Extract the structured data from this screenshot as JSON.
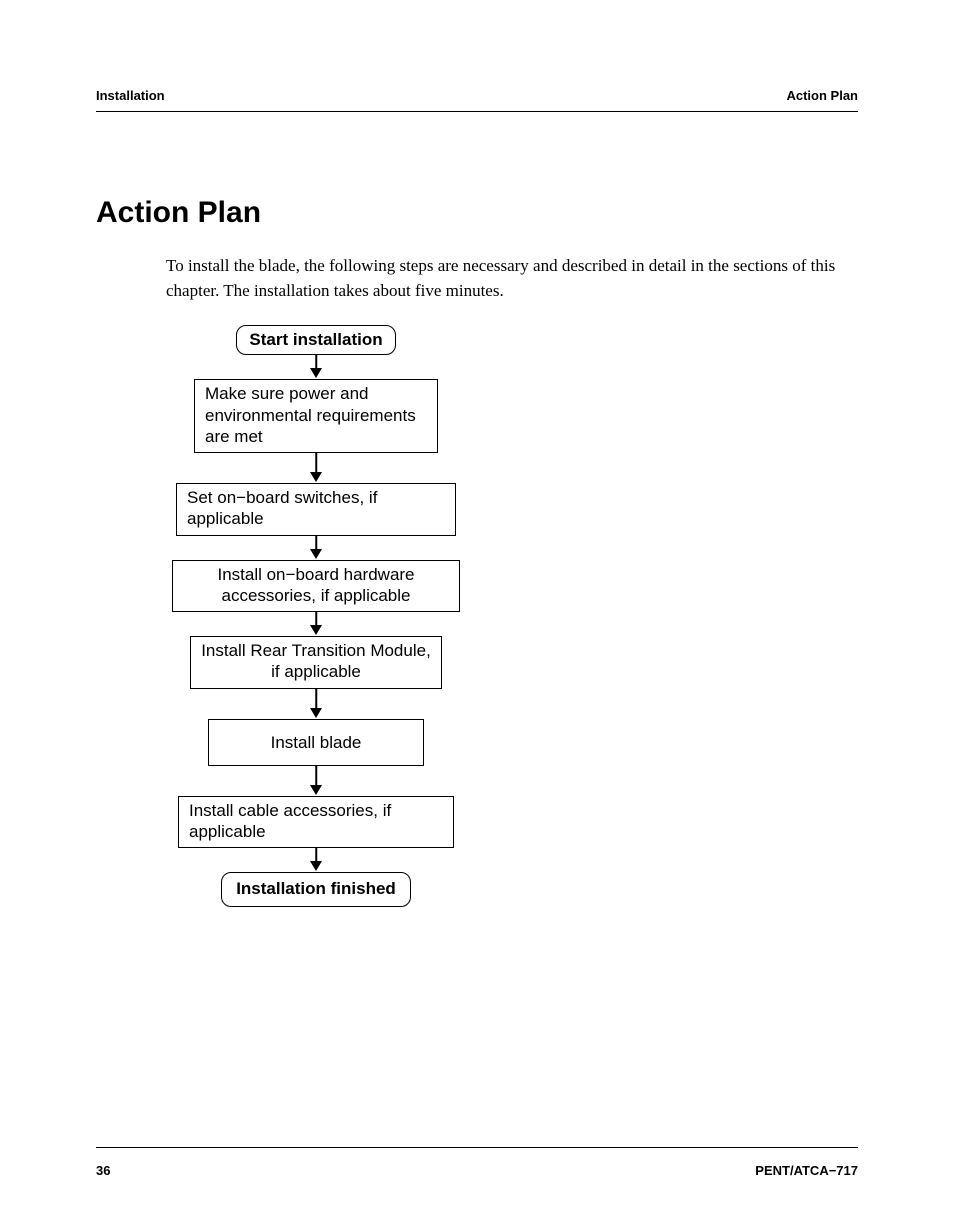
{
  "header": {
    "left": "Installation",
    "right": "Action Plan"
  },
  "title": "Action Plan",
  "intro": "To install the blade, the following steps are necessary and described in detail in the sections of this chapter. The installation takes about five minutes.",
  "flow": {
    "start": "Start installation",
    "step1": "Make sure power and environmental requirements are met",
    "step2": "Set on−board switches, if applicable",
    "step3": "Install on−board hardware accessories, if applicable",
    "step4": "Install Rear Transition Module, if applicable",
    "step5": "Install blade",
    "step6": "Install cable accessories, if applicable",
    "end": "Installation finished"
  },
  "footer": {
    "page": "36",
    "docid": "PENT/ATCA−717"
  }
}
